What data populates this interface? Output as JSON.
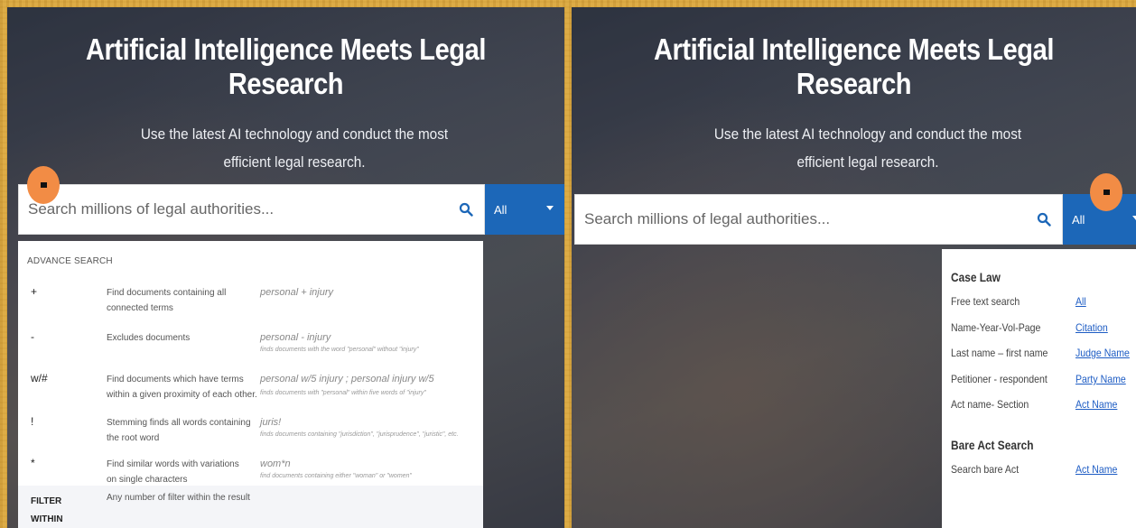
{
  "left": {
    "title": "Artificial Intelligence Meets Legal Research",
    "subtitle": "Use the latest AI technology and conduct the most efficient legal research.",
    "search_placeholder": "Search millions of legal authorities...",
    "select_value": "All",
    "advance_search": {
      "heading": "ADVANCE SEARCH",
      "rows": [
        {
          "symbol": "+",
          "desc": "Find documents containing all connected terms",
          "example": "personal + injury",
          "note": ""
        },
        {
          "symbol": "-",
          "desc": "Excludes documents",
          "example": "personal - injury",
          "note": "finds documents with the word \"personal\" without \"injury\""
        },
        {
          "symbol": "w/#",
          "desc": "Find documents which have terms within a given proximity of each other.",
          "example": "personal w/5 injury ; personal injury w/5",
          "note": "finds documents with \"personal\" within five words of \"injury\""
        },
        {
          "symbol": "!",
          "desc": "Stemming finds all words containing the root word",
          "example": "juris!",
          "note": "finds documents containing \"jurisdiction\", \"jurisprudence\", \"juristic\", etc."
        },
        {
          "symbol": "*",
          "desc": "Find similar words with variations on single characters",
          "example": "wom*n",
          "note": "find documents containing either \"woman\" or \"women\""
        }
      ],
      "filter_label": "FILTER WITHIN RESULT",
      "filter_desc": "Any number of filter within the result"
    }
  },
  "right": {
    "title": "Artificial Intelligence Meets Legal Research",
    "subtitle": "Use the latest AI technology and conduct the most efficient legal research.",
    "search_placeholder": "Search millions of legal authorities...",
    "select_value": "All",
    "dropdown": {
      "case_law_title": "Case Law",
      "case_law_rows": [
        {
          "label": "Free text search",
          "link": "All"
        },
        {
          "label": "Name-Year-Vol-Page",
          "link": "Citation"
        },
        {
          "label": "Last name – first name",
          "link": "Judge Name"
        },
        {
          "label": "Petitioner - respondent",
          "link": "Party Name"
        },
        {
          "label": "Act name- Section",
          "link": "Act Name"
        }
      ],
      "bare_act_title": "Bare Act Search",
      "bare_act_rows": [
        {
          "label": "Search bare Act",
          "link": "Act Name"
        }
      ]
    }
  },
  "colors": {
    "accent": "#1c67b8",
    "marker": "#f28c45",
    "link": "#1d5cc4",
    "frame": "#d9a63f"
  },
  "icons": {
    "search": "search-icon",
    "caret": "chevron-down-icon"
  }
}
